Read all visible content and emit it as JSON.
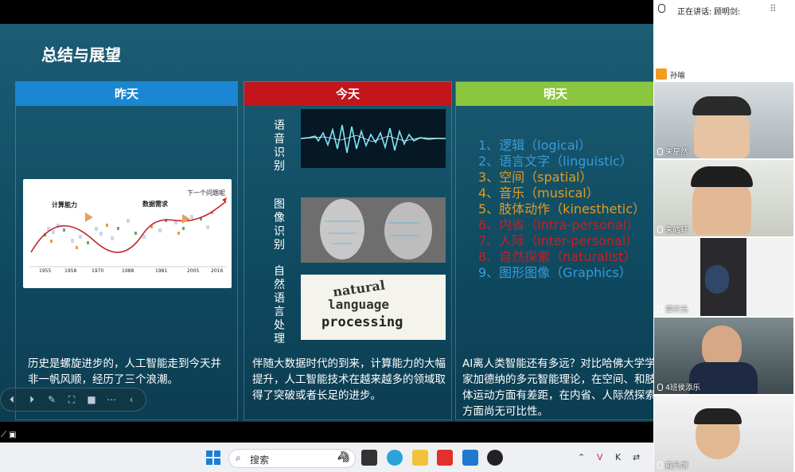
{
  "slide": {
    "title": "总结与展望",
    "col1": {
      "header": "昨天",
      "text": "历史是螺旋进步的，人工智能走到今天并非一帆风顺，经历了三个浪潮。",
      "chart": {
        "label1": "计算能力",
        "label2": "数据需求",
        "label3": "下一个问题呢",
        "years": [
          "1955",
          "1958",
          "1970",
          "1988",
          "1981",
          "2005",
          "2016"
        ]
      }
    },
    "col2": {
      "header": "今天",
      "text": "伴随大数据时代的到来，计算能力的大幅提升，人工智能技术在越来越多的领域取得了突破或者长足的进步。",
      "labels": [
        "语音识别",
        "图像识别",
        "自然语言处理"
      ],
      "nlp_words": [
        "natural",
        "language",
        "processing"
      ]
    },
    "col3": {
      "header": "明天",
      "text": "AI离人类智能还有多远？对比哈佛大学学家加德纳的多元智能理论，在空间、和肢体运动方面有差距，在内省、人际然探索方面尚无可比性。",
      "items": [
        {
          "text": "1、逻辑（logical）",
          "color": "#3a9ad9"
        },
        {
          "text": "2、语言文字（linguistic）",
          "color": "#3a9ad9"
        },
        {
          "text": "3、空间（spatial）",
          "color": "#e39b20"
        },
        {
          "text": "4、音乐（musical）",
          "color": "#e39b20"
        },
        {
          "text": "5、肢体动作（kinesthetic）",
          "color": "#e39b20"
        },
        {
          "text": "6、内省（intra-personal）",
          "color": "#c91f1f"
        },
        {
          "text": "7、人际（inter-personal）",
          "color": "#c91f1f"
        },
        {
          "text": "8、自然探索（naturalist）",
          "color": "#c91f1f"
        },
        {
          "text": "9、图形图像（Graphics）",
          "color": "#3a9ad9"
        }
      ]
    }
  },
  "panel": {
    "speaking_label": "正在讲话:",
    "speaking_name": "顾明剑:",
    "participants": [
      "孙喻",
      "朱星然",
      "朱皓轩",
      "谭齐元",
      "4班侯添乐",
      "戴凡博"
    ]
  },
  "taskbar": {
    "search_placeholder": "搜索"
  }
}
